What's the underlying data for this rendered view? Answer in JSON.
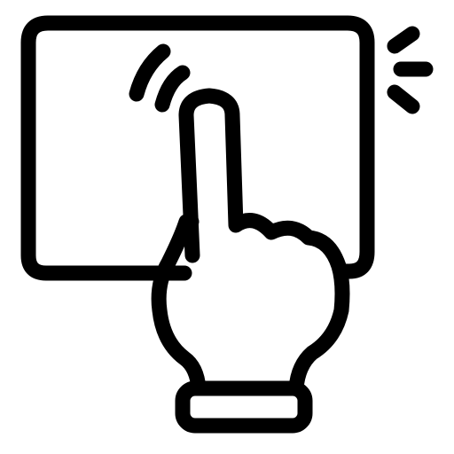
{
  "icon": {
    "name": "tap-touchpad-icon",
    "parts": [
      "touchpad",
      "hand",
      "cuff",
      "tap-waves",
      "tap-indicator"
    ],
    "stroke_color": "#000000",
    "background_color": "#ffffff"
  }
}
